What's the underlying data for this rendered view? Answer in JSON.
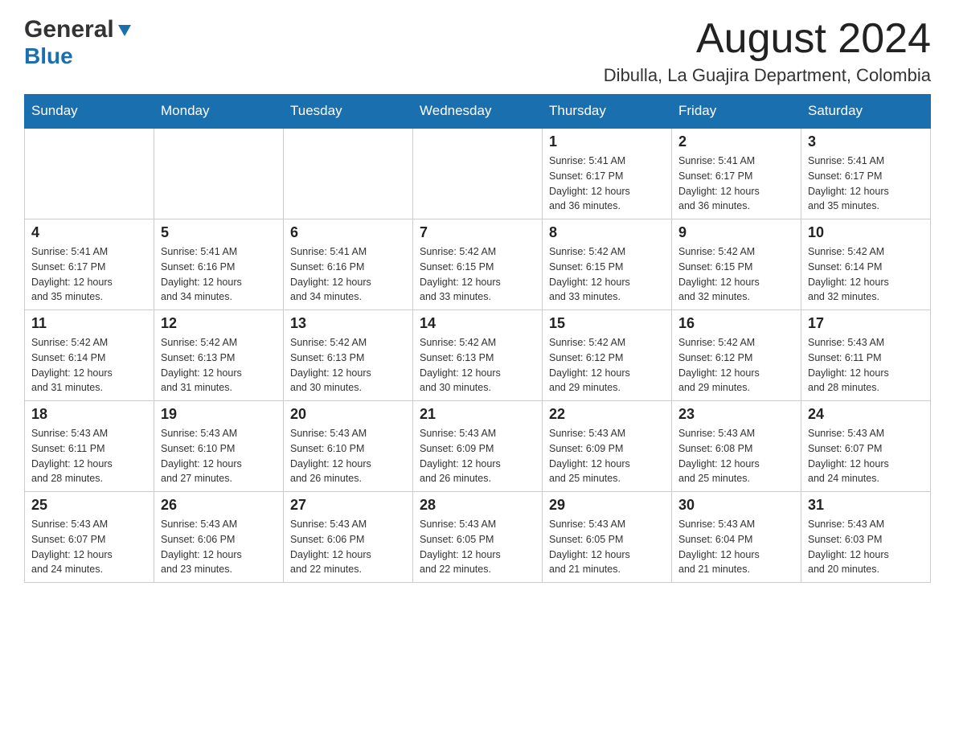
{
  "header": {
    "logo_general": "General",
    "logo_blue": "Blue",
    "month_year": "August 2024",
    "location": "Dibulla, La Guajira Department, Colombia"
  },
  "weekdays": [
    "Sunday",
    "Monday",
    "Tuesday",
    "Wednesday",
    "Thursday",
    "Friday",
    "Saturday"
  ],
  "weeks": [
    [
      {
        "day": "",
        "info": ""
      },
      {
        "day": "",
        "info": ""
      },
      {
        "day": "",
        "info": ""
      },
      {
        "day": "",
        "info": ""
      },
      {
        "day": "1",
        "info": "Sunrise: 5:41 AM\nSunset: 6:17 PM\nDaylight: 12 hours\nand 36 minutes."
      },
      {
        "day": "2",
        "info": "Sunrise: 5:41 AM\nSunset: 6:17 PM\nDaylight: 12 hours\nand 36 minutes."
      },
      {
        "day": "3",
        "info": "Sunrise: 5:41 AM\nSunset: 6:17 PM\nDaylight: 12 hours\nand 35 minutes."
      }
    ],
    [
      {
        "day": "4",
        "info": "Sunrise: 5:41 AM\nSunset: 6:17 PM\nDaylight: 12 hours\nand 35 minutes."
      },
      {
        "day": "5",
        "info": "Sunrise: 5:41 AM\nSunset: 6:16 PM\nDaylight: 12 hours\nand 34 minutes."
      },
      {
        "day": "6",
        "info": "Sunrise: 5:41 AM\nSunset: 6:16 PM\nDaylight: 12 hours\nand 34 minutes."
      },
      {
        "day": "7",
        "info": "Sunrise: 5:42 AM\nSunset: 6:15 PM\nDaylight: 12 hours\nand 33 minutes."
      },
      {
        "day": "8",
        "info": "Sunrise: 5:42 AM\nSunset: 6:15 PM\nDaylight: 12 hours\nand 33 minutes."
      },
      {
        "day": "9",
        "info": "Sunrise: 5:42 AM\nSunset: 6:15 PM\nDaylight: 12 hours\nand 32 minutes."
      },
      {
        "day": "10",
        "info": "Sunrise: 5:42 AM\nSunset: 6:14 PM\nDaylight: 12 hours\nand 32 minutes."
      }
    ],
    [
      {
        "day": "11",
        "info": "Sunrise: 5:42 AM\nSunset: 6:14 PM\nDaylight: 12 hours\nand 31 minutes."
      },
      {
        "day": "12",
        "info": "Sunrise: 5:42 AM\nSunset: 6:13 PM\nDaylight: 12 hours\nand 31 minutes."
      },
      {
        "day": "13",
        "info": "Sunrise: 5:42 AM\nSunset: 6:13 PM\nDaylight: 12 hours\nand 30 minutes."
      },
      {
        "day": "14",
        "info": "Sunrise: 5:42 AM\nSunset: 6:13 PM\nDaylight: 12 hours\nand 30 minutes."
      },
      {
        "day": "15",
        "info": "Sunrise: 5:42 AM\nSunset: 6:12 PM\nDaylight: 12 hours\nand 29 minutes."
      },
      {
        "day": "16",
        "info": "Sunrise: 5:42 AM\nSunset: 6:12 PM\nDaylight: 12 hours\nand 29 minutes."
      },
      {
        "day": "17",
        "info": "Sunrise: 5:43 AM\nSunset: 6:11 PM\nDaylight: 12 hours\nand 28 minutes."
      }
    ],
    [
      {
        "day": "18",
        "info": "Sunrise: 5:43 AM\nSunset: 6:11 PM\nDaylight: 12 hours\nand 28 minutes."
      },
      {
        "day": "19",
        "info": "Sunrise: 5:43 AM\nSunset: 6:10 PM\nDaylight: 12 hours\nand 27 minutes."
      },
      {
        "day": "20",
        "info": "Sunrise: 5:43 AM\nSunset: 6:10 PM\nDaylight: 12 hours\nand 26 minutes."
      },
      {
        "day": "21",
        "info": "Sunrise: 5:43 AM\nSunset: 6:09 PM\nDaylight: 12 hours\nand 26 minutes."
      },
      {
        "day": "22",
        "info": "Sunrise: 5:43 AM\nSunset: 6:09 PM\nDaylight: 12 hours\nand 25 minutes."
      },
      {
        "day": "23",
        "info": "Sunrise: 5:43 AM\nSunset: 6:08 PM\nDaylight: 12 hours\nand 25 minutes."
      },
      {
        "day": "24",
        "info": "Sunrise: 5:43 AM\nSunset: 6:07 PM\nDaylight: 12 hours\nand 24 minutes."
      }
    ],
    [
      {
        "day": "25",
        "info": "Sunrise: 5:43 AM\nSunset: 6:07 PM\nDaylight: 12 hours\nand 24 minutes."
      },
      {
        "day": "26",
        "info": "Sunrise: 5:43 AM\nSunset: 6:06 PM\nDaylight: 12 hours\nand 23 minutes."
      },
      {
        "day": "27",
        "info": "Sunrise: 5:43 AM\nSunset: 6:06 PM\nDaylight: 12 hours\nand 22 minutes."
      },
      {
        "day": "28",
        "info": "Sunrise: 5:43 AM\nSunset: 6:05 PM\nDaylight: 12 hours\nand 22 minutes."
      },
      {
        "day": "29",
        "info": "Sunrise: 5:43 AM\nSunset: 6:05 PM\nDaylight: 12 hours\nand 21 minutes."
      },
      {
        "day": "30",
        "info": "Sunrise: 5:43 AM\nSunset: 6:04 PM\nDaylight: 12 hours\nand 21 minutes."
      },
      {
        "day": "31",
        "info": "Sunrise: 5:43 AM\nSunset: 6:03 PM\nDaylight: 12 hours\nand 20 minutes."
      }
    ]
  ]
}
